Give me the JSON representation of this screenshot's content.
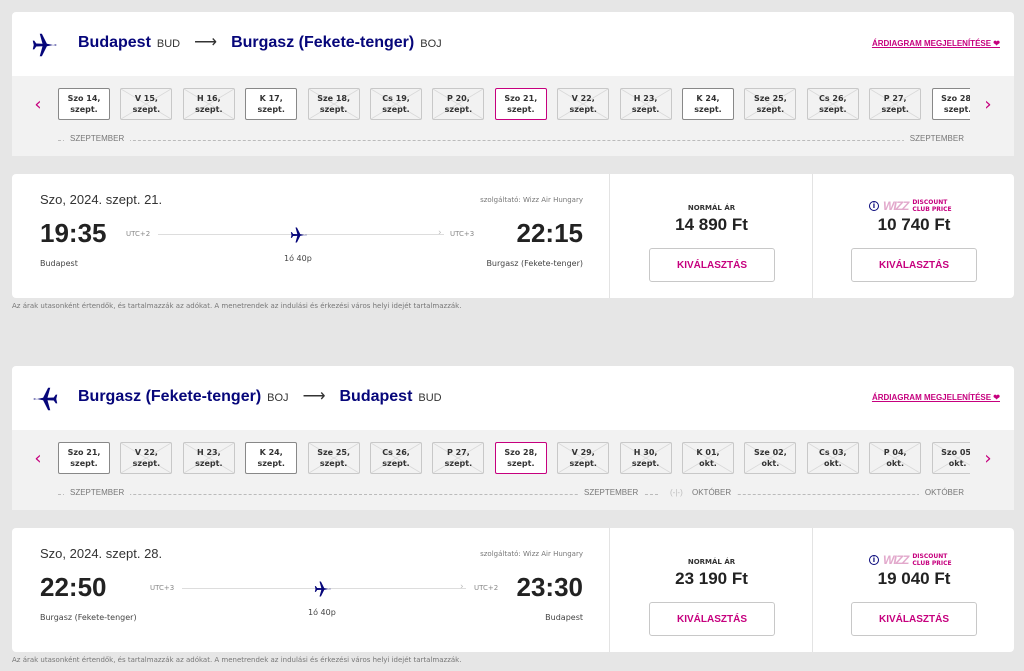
{
  "outbound": {
    "route": {
      "from_city": "Budapest",
      "from_code": "BUD",
      "to_city": "Burgasz (Fekete-tenger)",
      "to_code": "BOJ"
    },
    "chart_link": "ÁRDIAGRAM MEGJELENÍTÉSE ❤",
    "dates": [
      {
        "l1": "Szo 14,",
        "l2": "szept.",
        "state": "avail"
      },
      {
        "l1": "V 15,",
        "l2": "szept.",
        "state": "na"
      },
      {
        "l1": "H 16,",
        "l2": "szept.",
        "state": "na"
      },
      {
        "l1": "K 17,",
        "l2": "szept.",
        "state": "avail"
      },
      {
        "l1": "Sze 18,",
        "l2": "szept.",
        "state": "na"
      },
      {
        "l1": "Cs 19,",
        "l2": "szept.",
        "state": "na"
      },
      {
        "l1": "P 20,",
        "l2": "szept.",
        "state": "na"
      },
      {
        "l1": "Szo 21,",
        "l2": "szept.",
        "state": "sel"
      },
      {
        "l1": "V 22,",
        "l2": "szept.",
        "state": "na"
      },
      {
        "l1": "H 23,",
        "l2": "szept.",
        "state": "na"
      },
      {
        "l1": "K 24,",
        "l2": "szept.",
        "state": "avail"
      },
      {
        "l1": "Sze 25,",
        "l2": "szept.",
        "state": "na"
      },
      {
        "l1": "Cs 26,",
        "l2": "szept.",
        "state": "na"
      },
      {
        "l1": "P 27,",
        "l2": "szept.",
        "state": "na"
      },
      {
        "l1": "Szo 28,",
        "l2": "szept.",
        "state": "avail"
      }
    ],
    "months": {
      "left": "SZEPTEMBER",
      "right": "SZEPTEMBER"
    },
    "flight": {
      "date": "Szo, 2024. szept. 21.",
      "operator": "szolgáltató: Wizz Air Hungary",
      "dep_time": "19:35",
      "dep_utc": "UTC+2",
      "arr_time": "22:15",
      "arr_utc": "UTC+3",
      "duration": "1ó 40p",
      "dep_place": "Budapest",
      "arr_place": "Burgasz (Fekete-tenger)",
      "regular_label": "NORMÁL ÁR",
      "regular_price": "14 890 Ft",
      "club_price": "10 740 Ft",
      "select": "KIVÁLASZTÁS"
    }
  },
  "inbound": {
    "route": {
      "from_city": "Burgasz (Fekete-tenger)",
      "from_code": "BOJ",
      "to_city": "Budapest",
      "to_code": "BUD"
    },
    "chart_link": "ÁRDIAGRAM MEGJELENÍTÉSE ❤",
    "dates": [
      {
        "l1": "Szo 21,",
        "l2": "szept.",
        "state": "avail"
      },
      {
        "l1": "V 22,",
        "l2": "szept.",
        "state": "na"
      },
      {
        "l1": "H 23,",
        "l2": "szept.",
        "state": "na"
      },
      {
        "l1": "K 24,",
        "l2": "szept.",
        "state": "avail"
      },
      {
        "l1": "Sze 25,",
        "l2": "szept.",
        "state": "na"
      },
      {
        "l1": "Cs 26,",
        "l2": "szept.",
        "state": "na"
      },
      {
        "l1": "P 27,",
        "l2": "szept.",
        "state": "na"
      },
      {
        "l1": "Szo 28,",
        "l2": "szept.",
        "state": "sel"
      },
      {
        "l1": "V 29,",
        "l2": "szept.",
        "state": "na"
      },
      {
        "l1": "H 30,",
        "l2": "szept.",
        "state": "na"
      },
      {
        "l1": "K 01,",
        "l2": "okt.",
        "state": "na"
      },
      {
        "l1": "Sze 02,",
        "l2": "okt.",
        "state": "na"
      },
      {
        "l1": "Cs 03,",
        "l2": "okt.",
        "state": "na"
      },
      {
        "l1": "P 04,",
        "l2": "okt.",
        "state": "na"
      },
      {
        "l1": "Szo 05,",
        "l2": "okt.",
        "state": "na"
      }
    ],
    "months": {
      "left": "SZEPTEMBER",
      "mid_left": "SZEPTEMBER",
      "mid_right": "OKTÓBER",
      "right": "OKTÓBER"
    },
    "flight": {
      "date": "Szo, 2024. szept. 28.",
      "operator": "szolgáltató: Wizz Air Hungary",
      "dep_time": "22:50",
      "dep_utc": "UTC+3",
      "arr_time": "23:30",
      "arr_utc": "UTC+2",
      "duration": "1ó 40p",
      "dep_place": "Burgasz (Fekete-tenger)",
      "arr_place": "Budapest",
      "regular_label": "NORMÁL ÁR",
      "regular_price": "23 190 Ft",
      "club_price": "19 040 Ft",
      "select": "KIVÁLASZTÁS"
    }
  },
  "club": {
    "wizz": "WIZZ",
    "line1": "DISCOUNT",
    "line2": "CLUB PRICE"
  },
  "note": "Az árak utasonként értendők, és tartalmazzák az adókat. A menetrendek az indulási és érkezési város helyi idejét tartalmazzák.",
  "colors": {
    "brand": "#06067a",
    "accent": "#c6007e"
  }
}
